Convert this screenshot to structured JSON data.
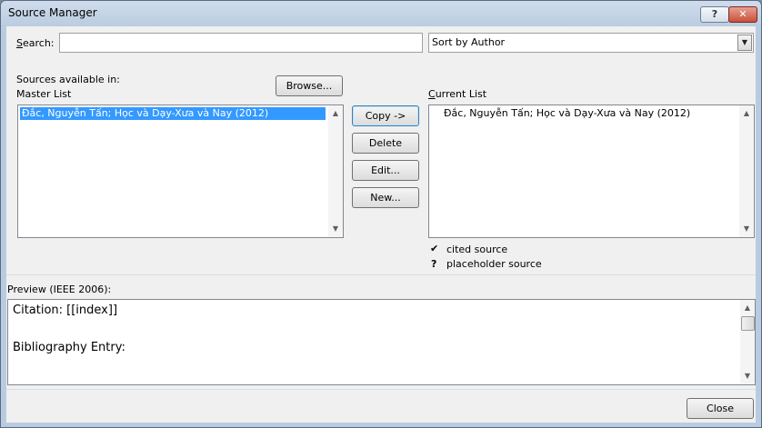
{
  "window": {
    "title": "Source Manager",
    "help_label": "?",
    "close_label": "✕"
  },
  "search": {
    "label_pre": "",
    "label_u": "S",
    "label_post": "earch:",
    "value": "",
    "sort_value": "Sort by Author"
  },
  "sources": {
    "available_in_label": "Sources available in:",
    "master_label": "Master List",
    "browse_label": "Browse...",
    "current_label_pre": "",
    "current_label_u": "C",
    "current_label_post": "urrent List",
    "master_items": [
      "Đắc, Nguyễn Tấn; Học và Dạy-Xưa và Nay (2012)"
    ],
    "current_items": [
      "Đắc, Nguyễn Tấn; Học và Dạy-Xưa và Nay (2012)"
    ]
  },
  "actions": {
    "copy": "Copy ->",
    "delete": "Delete",
    "edit": "Edit...",
    "new": "New..."
  },
  "legend": {
    "cited_mark": "✔",
    "cited_label": "cited source",
    "placeholder_mark": "?",
    "placeholder_label": "placeholder source"
  },
  "preview": {
    "label": "Preview (IEEE 2006):",
    "citation": "Citation:  [[index]]",
    "bibliography": "Bibliography Entry:"
  },
  "footer": {
    "close_label": "Close"
  }
}
